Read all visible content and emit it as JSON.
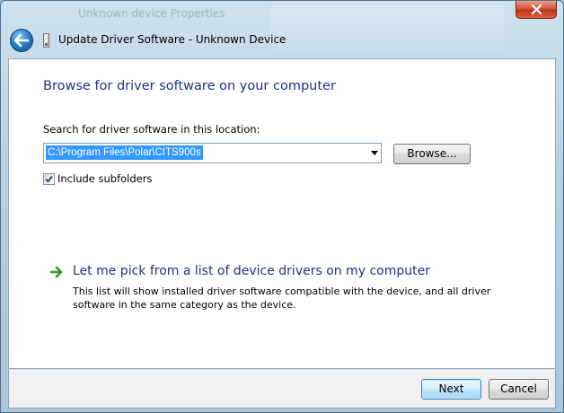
{
  "window": {
    "background_title": "Unknown device Properties",
    "title": "Update Driver Software - Unknown Device"
  },
  "icons": {
    "close": "close-icon",
    "back": "back-arrow-icon",
    "device": "device-icon",
    "link_arrow": "green-arrow-icon",
    "checkmark": "checkmark-icon"
  },
  "main": {
    "heading": "Browse for driver software on your computer",
    "search_label": "Search for driver software in this location:",
    "path_value": "C:\\Program Files\\Polar\\CITS900s",
    "browse_label": "Browse...",
    "include_subfolders": {
      "label": "Include subfolders",
      "checked": true
    },
    "pick_option": {
      "title": "Let me pick from a list of device drivers on my computer",
      "description": "This list will show installed driver software compatible with the device, and all driver software in the same category as the device."
    }
  },
  "footer": {
    "next_label": "Next",
    "cancel_label": "Cancel"
  },
  "colors": {
    "heading": "#1e3287",
    "selection": "#3399ff",
    "link_arrow": "#2a9a2a"
  }
}
